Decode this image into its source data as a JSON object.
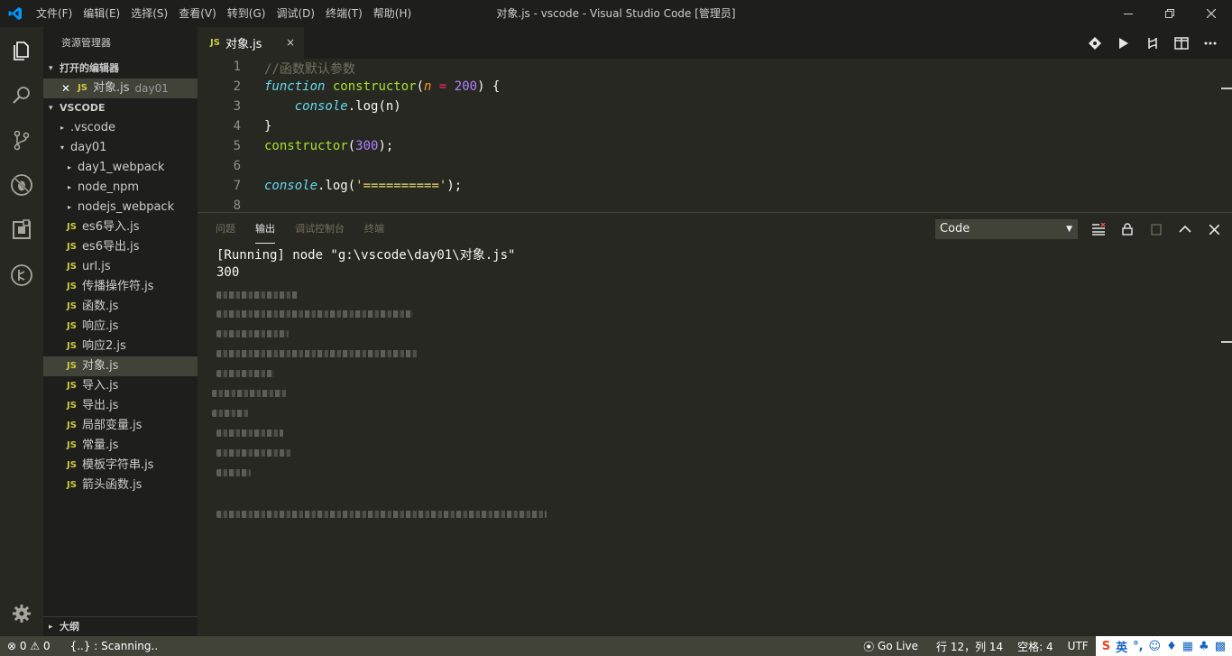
{
  "titlebar": {
    "menu": [
      "文件(F)",
      "编辑(E)",
      "选择(S)",
      "查看(V)",
      "转到(G)",
      "调试(D)",
      "终端(T)",
      "帮助(H)"
    ],
    "title": "对象.js - vscode - Visual Studio Code [管理员]"
  },
  "sidebar": {
    "header": "资源管理器",
    "open_editors_label": "打开的编辑器",
    "open_editor": {
      "name": "对象.js",
      "folder": "day01"
    },
    "workspace_label": "VSCODE",
    "tree": [
      {
        "label": ".vscode",
        "type": "folder",
        "depth": 0,
        "expanded": false
      },
      {
        "label": "day01",
        "type": "folder",
        "depth": 0,
        "expanded": true
      },
      {
        "label": "day1_webpack",
        "type": "folder",
        "depth": 1,
        "expanded": false
      },
      {
        "label": "node_npm",
        "type": "folder",
        "depth": 1,
        "expanded": false
      },
      {
        "label": "nodejs_webpack",
        "type": "folder",
        "depth": 1,
        "expanded": false
      },
      {
        "label": "es6导入.js",
        "type": "js",
        "depth": 1
      },
      {
        "label": "es6导出.js",
        "type": "js",
        "depth": 1
      },
      {
        "label": "url.js",
        "type": "js",
        "depth": 1
      },
      {
        "label": "传播操作符.js",
        "type": "js",
        "depth": 1
      },
      {
        "label": "函数.js",
        "type": "js",
        "depth": 1
      },
      {
        "label": "响应.js",
        "type": "js",
        "depth": 1
      },
      {
        "label": "响应2.js",
        "type": "js",
        "depth": 1
      },
      {
        "label": "对象.js",
        "type": "js",
        "depth": 1,
        "selected": true
      },
      {
        "label": "导入.js",
        "type": "js",
        "depth": 1
      },
      {
        "label": "导出.js",
        "type": "js",
        "depth": 1
      },
      {
        "label": "局部变量.js",
        "type": "js",
        "depth": 1
      },
      {
        "label": "常量.js",
        "type": "js",
        "depth": 1
      },
      {
        "label": "模板字符串.js",
        "type": "js",
        "depth": 1
      },
      {
        "label": "箭头函数.js",
        "type": "js",
        "depth": 1
      }
    ],
    "outline_label": "大纲",
    "js_badge": "JS"
  },
  "tab": {
    "label": "对象.js",
    "close": "×"
  },
  "code": {
    "line_numbers": [
      "1",
      "2",
      "3",
      "4",
      "5",
      "6",
      "7",
      "8"
    ],
    "l1": "//函数默认参数",
    "l2_kw": "function",
    "l2_fn": "constructor",
    "l2_open": "(",
    "l2_param": "n",
    "l2_eq": "=",
    "l2_num": "200",
    "l2_close": ") {",
    "l3_obj": "console",
    "l3_rest": ".log(n)",
    "l4": "}",
    "l5_fn": "constructor",
    "l5_open": "(",
    "l5_num": "300",
    "l5_close": ");",
    "l7_obj": "console",
    "l7_mid": ".log(",
    "l7_str": "'=========='",
    "l7_end": ");"
  },
  "panel": {
    "tabs": [
      "问题",
      "输出",
      "调试控制台",
      "终端"
    ],
    "active_tab": "输出",
    "select_value": "Code",
    "output": [
      "[Running] node \"g:\\vscode\\day01\\对象.js\"",
      "300"
    ]
  },
  "status": {
    "errors": "0",
    "warnings": "0",
    "scanning": "{..} : Scanning..",
    "golive": "Go Live",
    "position": "行 12，列 14",
    "spaces": "空格: 4",
    "encoding": "UTF",
    "ime_lang": "英"
  },
  "colors": {
    "accent": "#66d9ef",
    "js_icon": "#cbcb41",
    "statusbar": "#414339"
  }
}
